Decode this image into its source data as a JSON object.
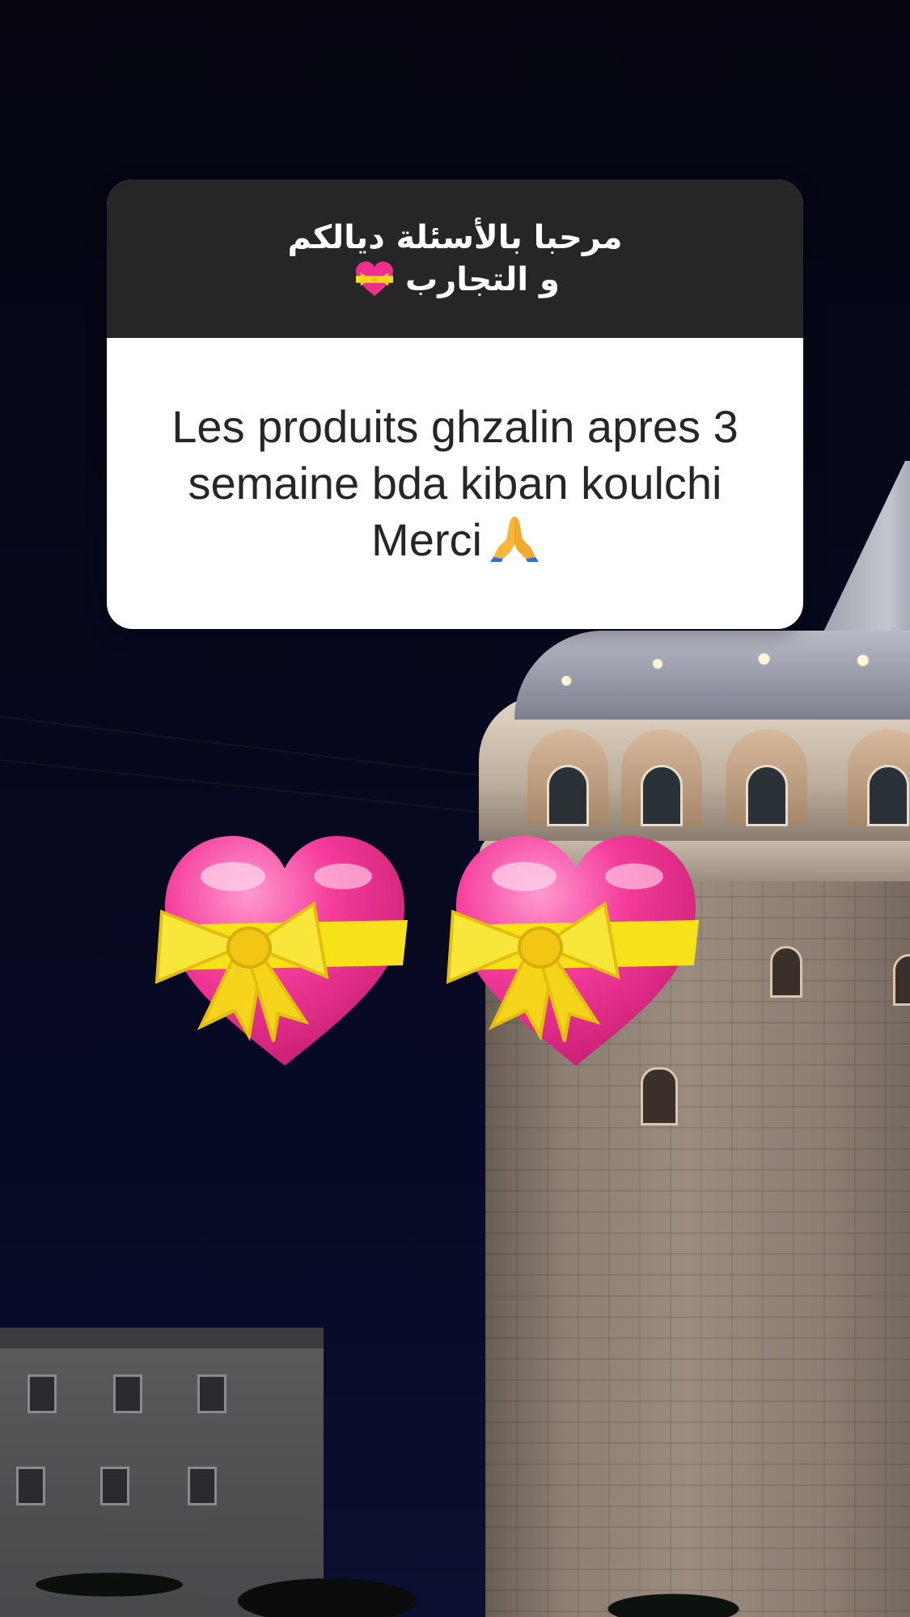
{
  "question_sticker": {
    "prompt_line1": "مرحبا بالأسئلة ديالكم",
    "prompt_line2": "و التجارب",
    "prompt_icon": "heart-with-ribbon-icon",
    "answer": "Les produits ghzalin apres 3 semaine bda kiban koulchi Merci",
    "answer_icon": "folded-hands-icon"
  },
  "stickers": [
    {
      "icon": "heart-with-ribbon-icon"
    },
    {
      "icon": "heart-with-ribbon-icon"
    }
  ],
  "colors": {
    "card_header": "#262626",
    "card_body": "#ffffff",
    "heart_pink": "#ef2f8e",
    "ribbon_yellow": "#f7e21a"
  }
}
